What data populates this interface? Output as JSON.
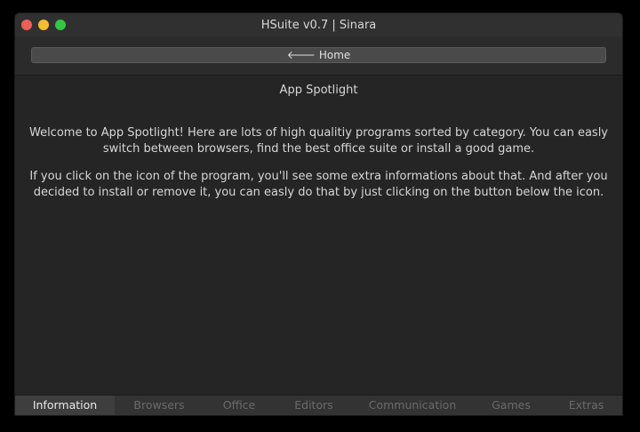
{
  "window": {
    "title": "HSuite v0.7 | Sinara"
  },
  "toolbar": {
    "home_icon": "arrow-left-icon",
    "home_label": "Home"
  },
  "main": {
    "heading": "App Spotlight",
    "paragraph1": "Welcome to App Spotlight! Here are lots of high qualitiy programs sorted by category. You can easly switch between browsers, find the best office suite or install a good game.",
    "paragraph2": "If you click on the icon of the program, you'll see some extra informations about that. And after you decided to install or remove it, you can easly do that by just clicking on the button below the icon."
  },
  "tabs": [
    {
      "label": "Information",
      "active": true
    },
    {
      "label": "Browsers",
      "active": false
    },
    {
      "label": "Office",
      "active": false
    },
    {
      "label": "Editors",
      "active": false
    },
    {
      "label": "Communication",
      "active": false
    },
    {
      "label": "Games",
      "active": false
    },
    {
      "label": "Extras",
      "active": false
    }
  ],
  "colors": {
    "window_bg": "#2b2b2b",
    "content_bg": "#252525",
    "active_tab_bg": "#3e3e3e",
    "close": "#ec5f57",
    "minimize": "#f5bd31",
    "maximize": "#36c545"
  }
}
